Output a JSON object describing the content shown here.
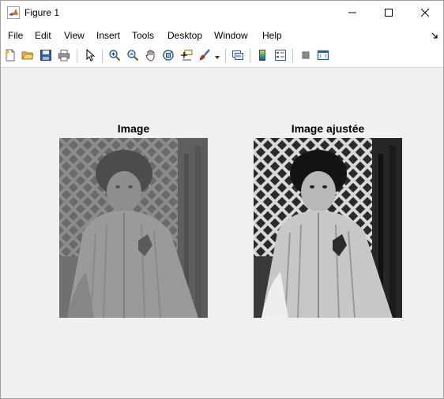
{
  "window": {
    "title": "Figure 1"
  },
  "menu": {
    "items": [
      "File",
      "Edit",
      "View",
      "Insert",
      "Tools",
      "Desktop",
      "Window",
      "Help"
    ]
  },
  "toolbar": {
    "buttons": [
      "new-figure",
      "open-file",
      "save",
      "print",
      "edit-plot",
      "zoom-in",
      "zoom-out",
      "pan",
      "rotate-3d",
      "data-cursor",
      "brush",
      "link-plot",
      "colorbar",
      "legend",
      "hide-plot-tools",
      "show-plot-tools"
    ]
  },
  "axes": [
    {
      "title": "Image"
    },
    {
      "title": "Image ajustée"
    }
  ]
}
